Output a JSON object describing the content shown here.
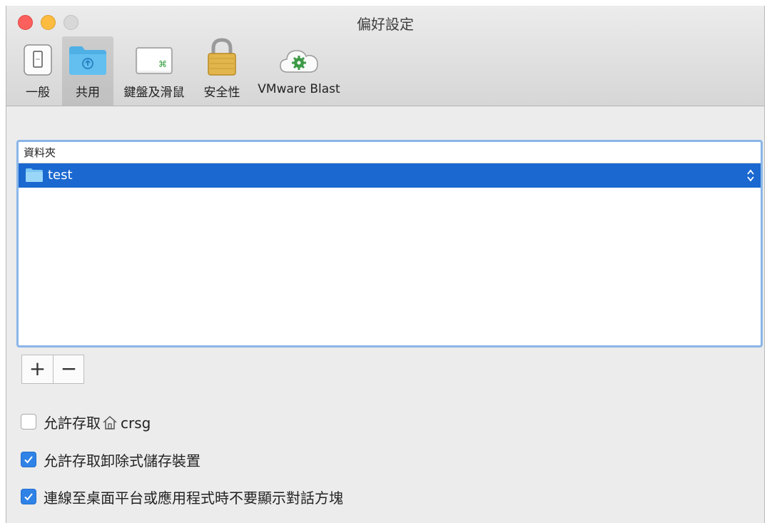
{
  "window": {
    "title": "偏好設定"
  },
  "toolbar": {
    "items": [
      {
        "label": "一般",
        "icon": "switch-icon"
      },
      {
        "label": "共用",
        "icon": "shared-folder-icon",
        "selected": true
      },
      {
        "label": "鍵盤及滑鼠",
        "icon": "keyboard-command-icon"
      },
      {
        "label": "安全性",
        "icon": "padlock-icon"
      },
      {
        "label": "VMware Blast",
        "icon": "cloud-gear-icon"
      }
    ]
  },
  "sharing": {
    "list_header": "資料夾",
    "folders": [
      {
        "name": "test",
        "selected": true
      }
    ],
    "add_label": "+",
    "remove_label": "−"
  },
  "options": [
    {
      "label": "允許存取",
      "icon": "home-icon",
      "value": "crsg",
      "checked": false
    },
    {
      "label": "允許存取卸除式儲存裝置",
      "checked": true
    },
    {
      "label": "連線至桌面平台或應用程式時不要顯示對話方塊",
      "checked": true
    }
  ],
  "colors": {
    "selection": "#1a68d0",
    "focus_ring": "#8ab6e8",
    "checkbox_on": "#2f82e6"
  }
}
